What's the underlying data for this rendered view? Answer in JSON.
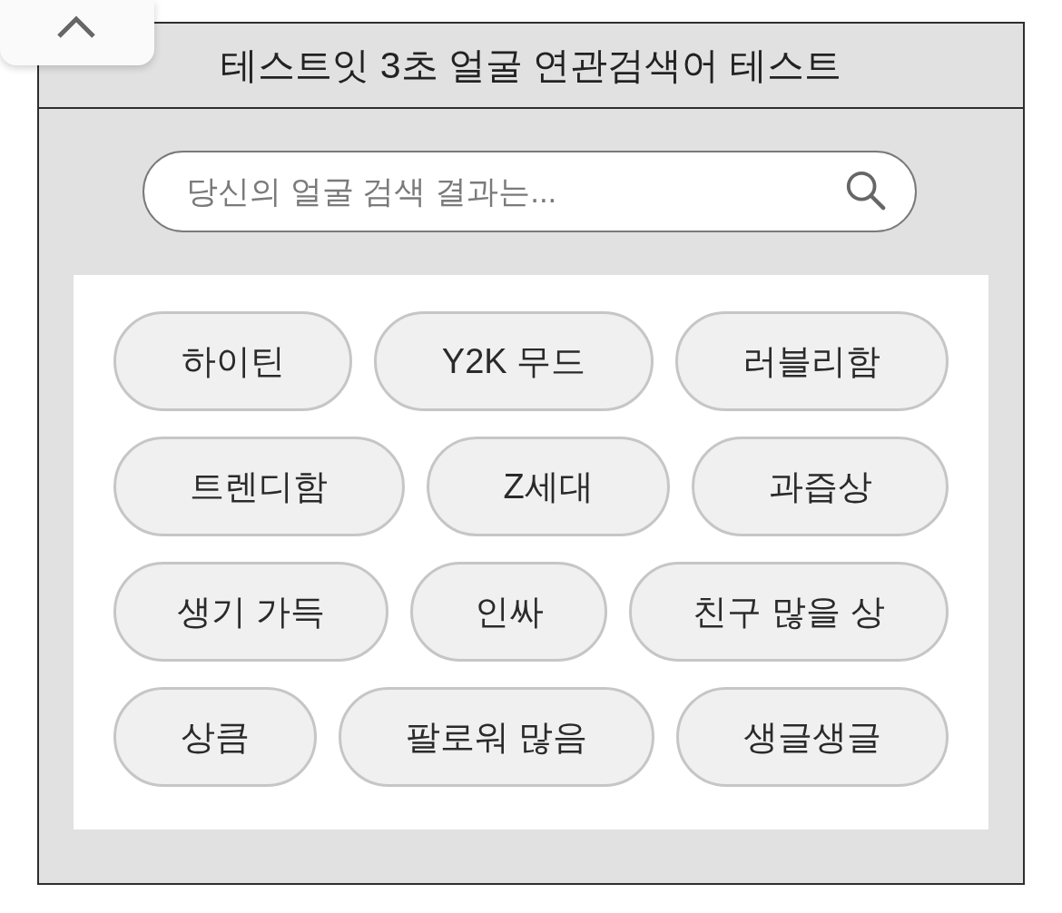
{
  "panel": {
    "title": "테스트잇 3초 얼굴 연관검색어 테스트"
  },
  "search": {
    "placeholder": "당신의 얼굴 검색 결과는..."
  },
  "keyword_rows": [
    {
      "keywords": [
        "하이틴",
        "Y2K 무드",
        "러블리함"
      ]
    },
    {
      "keywords": [
        "트렌디함",
        "Z세대",
        "과즙상"
      ]
    },
    {
      "keywords": [
        "생기 가득",
        "인싸",
        "친구 많을 상"
      ]
    },
    {
      "keywords": [
        "상큼",
        "팔로워 많음",
        "생글생글"
      ]
    }
  ]
}
